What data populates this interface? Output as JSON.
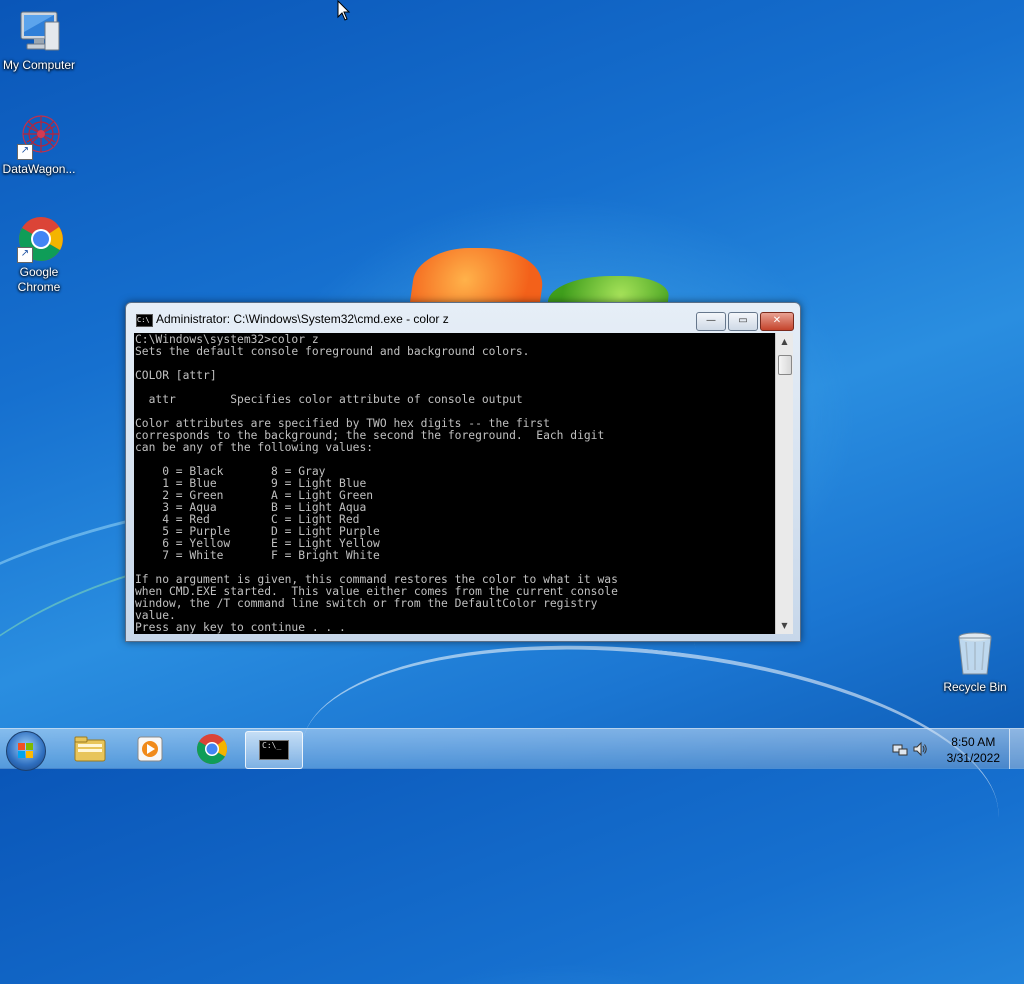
{
  "desktop": {
    "icons": [
      {
        "label": "My Computer",
        "icon": "computer-icon"
      },
      {
        "label": "DataWagon...",
        "icon": "datawagon-icon"
      },
      {
        "label": "Google Chrome",
        "icon": "chrome-icon"
      },
      {
        "label": "Recycle Bin",
        "icon": "recycle-bin-icon"
      }
    ]
  },
  "cmd_window": {
    "title": "Administrator: C:\\Windows\\System32\\cmd.exe - color z",
    "minimize_label": "—",
    "maximize_label": "▭",
    "close_label": "✕",
    "icon_text": "C:\\",
    "console_lines": [
      "C:\\Windows\\system32>color z",
      "Sets the default console foreground and background colors.",
      "",
      "COLOR [attr]",
      "",
      "  attr        Specifies color attribute of console output",
      "",
      "Color attributes are specified by TWO hex digits -- the first",
      "corresponds to the background; the second the foreground.  Each digit",
      "can be any of the following values:",
      "",
      "    0 = Black       8 = Gray",
      "    1 = Blue        9 = Light Blue",
      "    2 = Green       A = Light Green",
      "    3 = Aqua        B = Light Aqua",
      "    4 = Red         C = Light Red",
      "    5 = Purple      D = Light Purple",
      "    6 = Yellow      E = Light Yellow",
      "    7 = White       F = Bright White",
      "",
      "If no argument is given, this command restores the color to what it was",
      "when CMD.EXE started.  This value either comes from the current console",
      "window, the /T command line switch or from the DefaultColor registry",
      "value.",
      "Press any key to continue . . ."
    ]
  },
  "taskbar": {
    "apps": [
      {
        "name": "explorer-icon"
      },
      {
        "name": "media-player-icon"
      },
      {
        "name": "chrome-icon"
      },
      {
        "name": "cmd-icon",
        "active": true,
        "icon_text": "C:\\_"
      }
    ],
    "clock": {
      "time": "8:50 AM",
      "date": "3/31/2022"
    }
  },
  "colors": {
    "console_bg": "#000000",
    "console_fg": "#c0c0c0",
    "desktop_blue": "#1670cf"
  }
}
